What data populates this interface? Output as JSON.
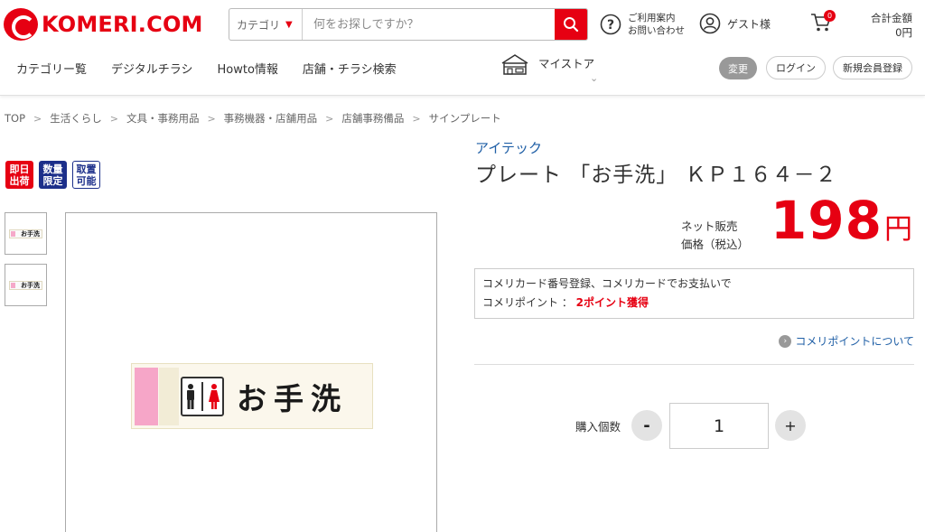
{
  "header": {
    "logo_text": "KOMERI.COM",
    "search": {
      "category_label": "カテゴリ",
      "placeholder": "何をお探しですか？"
    },
    "help_line1": "ご利用案内",
    "help_line2": "お問い合わせ",
    "guest_label": "ゲスト様",
    "cart_count": "0",
    "total_label": "合計金額",
    "total_value": "0円",
    "nav": [
      {
        "label": "カテゴリー覧"
      },
      {
        "label": "デジタルチラシ"
      },
      {
        "label": "Howto情報"
      },
      {
        "label": "店舗・チラシ検索"
      }
    ],
    "mystore_label": "マイストア",
    "change_label": "変更",
    "login_label": "ログイン",
    "register_label": "新規会員登録"
  },
  "breadcrumb": [
    {
      "label": "TOP"
    },
    {
      "label": "生活くらし"
    },
    {
      "label": "文具・事務用品"
    },
    {
      "label": "事務機器・店舗用品"
    },
    {
      "label": "店舗事務備品"
    },
    {
      "label": "サインプレート"
    }
  ],
  "badges": [
    {
      "label": "即日出荷",
      "color": "#e60012"
    },
    {
      "label": "数量限定",
      "color": "#1c2f8a"
    },
    {
      "label": "取置可能",
      "color": "#1c2f8a"
    }
  ],
  "product": {
    "brand": "アイテック",
    "name": "プレート 「お手洗」 ＫＰ１６４－２",
    "price_label_line1": "ネット販売",
    "price_label_line2": "価格（税込）",
    "price": "198",
    "currency": "円",
    "image_text": "お手洗",
    "thumb_text": "お手洗"
  },
  "points": {
    "line1": "コメリカード番号登録、コメリカードでお支払いで",
    "line2_prefix": "コメリポイント ： ",
    "line2_value": "2ポイント獲得",
    "link_label": "コメリポイントについて"
  },
  "quantity": {
    "label": "購入個数",
    "value": "1",
    "minus": "-",
    "plus": "+"
  },
  "colors": {
    "brand_red": "#e60012",
    "link_blue": "#1f5fa6",
    "badge_navy": "#1c2f8a"
  }
}
